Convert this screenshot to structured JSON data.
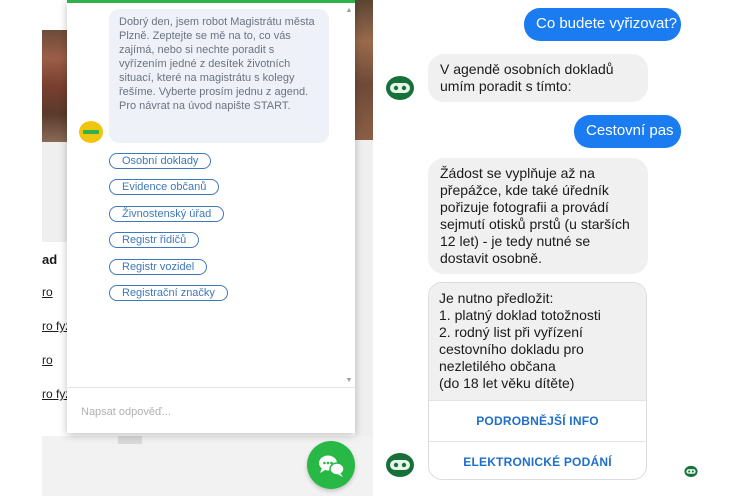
{
  "left_panel": {
    "bg_links": [
      "ro",
      "ro fyz",
      "ro",
      "ro fyz"
    ],
    "bg_heading": "ad",
    "chat": {
      "greeting": "Dobrý den, jsem robot Magistrátu města Plzně. Zeptejte se mě na to, co vás zajímá, nebo si nechte poradit s vyřízením jedné z desítek životních situací, které na magistrátu s kolegy řešíme. Vyberte prosím jednu z agend. Pro návrat na úvod napište START.",
      "quick_replies": [
        "Osobní doklady",
        "Evidence občanů",
        "Živnostenský úřad",
        "Registr řidičů",
        "Registr vozidel",
        "Registrační značky"
      ],
      "input_placeholder": "Napsat odpověď...",
      "scroll_up_icon": "▲",
      "scroll_down_icon": "▼"
    },
    "launcher_icon": "chat-bubbles-icon",
    "colors": {
      "accent": "#2db24a",
      "link": "#3f78b8"
    }
  },
  "right_panel": {
    "messages": [
      {
        "from": "user",
        "text": "Co budete vyřizovat?"
      },
      {
        "from": "bot",
        "text": "V agendě osobních dokladů umím poradit s tímto:"
      },
      {
        "from": "user",
        "text": "Cestovní pas"
      },
      {
        "from": "bot",
        "text": "Žádost se vyplňuje až na přepážce, kde také úředník pořizuje fotografii a provádí sejmutí otisků prstů (u starších 12 let) - je tedy nutné se dostavit osobně."
      }
    ],
    "card": {
      "text": "Je nutno předložit:\n1. platný doklad totožnosti\n2. rodný list při vyřízení cestovního dokladu pro nezletilého občana\n(do 18 let věku dítěte)",
      "buttons": [
        "PODROBNĚJŠÍ INFO",
        "ELEKTRONICKÉ PODÁNÍ"
      ]
    },
    "colors": {
      "user_bubble": "#1b7cf2",
      "bot_bubble": "#f0f0f0",
      "button_text": "#1f6fc9"
    }
  }
}
